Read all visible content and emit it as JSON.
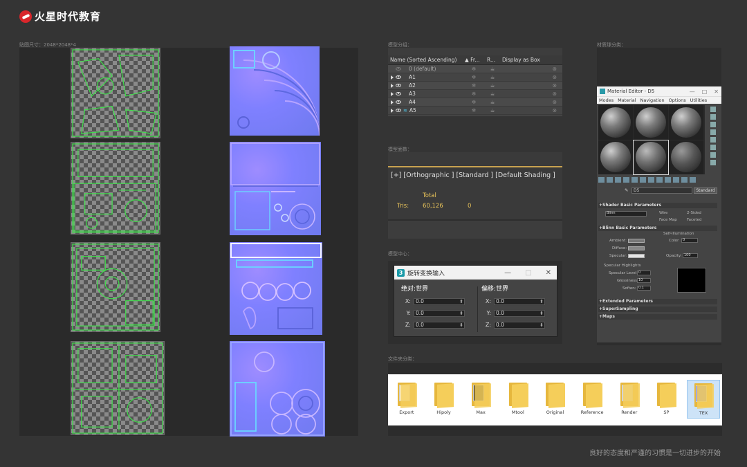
{
  "brand": {
    "name": "火星时代教育",
    "color": "#d9262b"
  },
  "captions": {
    "uv_resolution": "贴图尺寸：2048*2048*4",
    "scene_list": "模型分组：",
    "viewport": "模型面数：",
    "rotation": "模型中心：",
    "folders": "文件夹分类：",
    "material": "材质球分类："
  },
  "scene_explorer": {
    "columns": [
      "Name (Sorted Ascending)",
      "▲ Fr...",
      "R...",
      "Display as Box"
    ],
    "rows": [
      {
        "name": "0 (default)"
      },
      {
        "name": "A1"
      },
      {
        "name": "A2"
      },
      {
        "name": "A3"
      },
      {
        "name": "A4"
      },
      {
        "name": "A5"
      }
    ]
  },
  "viewport": {
    "label": "[+] [Orthographic ] [Standard ] [Default Shading ]",
    "total_label": "Total",
    "tris_label": "Tris:",
    "tris_total": "60,126",
    "tris_selected": "0"
  },
  "rotate_dialog": {
    "icon": "3",
    "title": "旋转变换输入",
    "absolute_header": "绝对:世界",
    "offset_header": "偏移:世界",
    "axes": [
      "X:",
      "Y:",
      "Z:"
    ],
    "absolute_values": [
      "0.0",
      "0.0",
      "0.0"
    ],
    "offset_values": [
      "0.0",
      "0.0",
      "0.0"
    ]
  },
  "folders": [
    {
      "label": "Export",
      "selected": false
    },
    {
      "label": "Hipoly",
      "selected": false
    },
    {
      "label": "Max",
      "selected": false
    },
    {
      "label": "Mtool",
      "selected": false
    },
    {
      "label": "Original",
      "selected": false
    },
    {
      "label": "Reference",
      "selected": false
    },
    {
      "label": "Render",
      "selected": false
    },
    {
      "label": "SP",
      "selected": false
    },
    {
      "label": "TEX",
      "selected": true
    }
  ],
  "material_editor": {
    "title": "Material Editor - D5",
    "menu": [
      "Modes",
      "Material",
      "Navigation",
      "Options",
      "Utilities"
    ],
    "material_name": "D5",
    "material_type": "Standard",
    "sections": {
      "shader": "Shader Basic Parameters",
      "blinn": "Blinn Basic Parameters",
      "extended": "Extended Parameters",
      "supersampling": "SuperSampling",
      "maps": "Maps"
    },
    "shader_type": "Blinn",
    "options": [
      "Wire",
      "2-Sided",
      "Face Map",
      "Faceted"
    ],
    "self_illum_label": "Self-Illumination",
    "color_label": "Color",
    "color_value": "0",
    "ambient_label": "Ambient:",
    "diffuse_label": "Diffuse:",
    "specular_label": "Specular:",
    "opacity_label": "Opacity:",
    "opacity_value": "100",
    "highlights_label": "Specular Highlights",
    "spec_level_label": "Specular Level:",
    "spec_level_value": "0",
    "glossiness_label": "Glossiness:",
    "glossiness_value": "10",
    "soften_label": "Soften:",
    "soften_value": "0.1"
  },
  "footer": "良好的态度和严谨的习惯是一切进步的开始"
}
